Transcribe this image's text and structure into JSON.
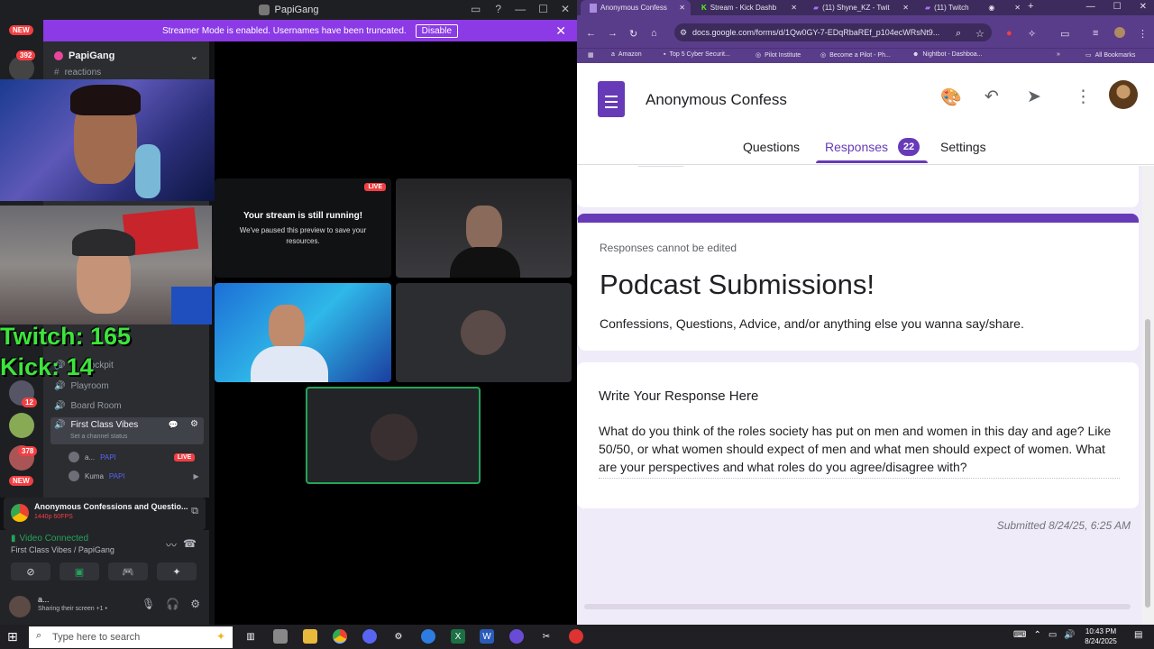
{
  "discord": {
    "window_title": "PapiGang",
    "banner_text": "Streamer Mode is enabled. Usernames have been truncated.",
    "banner_button": "Disable",
    "server_name": "PapiGang",
    "guild_badges": [
      "NEW",
      "392",
      "12",
      "378",
      "NEW"
    ],
    "channels": [
      {
        "label": "reactions",
        "icon": "hash-icon"
      },
      {
        "label": "Cockpit",
        "icon": "speaker-icon"
      },
      {
        "label": "Playroom",
        "icon": "speaker-icon"
      },
      {
        "label": "Board Room",
        "icon": "speaker-icon"
      },
      {
        "label": "First Class Vibes",
        "icon": "speaker-icon",
        "status": "Set a channel status"
      }
    ],
    "members": [
      {
        "name": "a...",
        "tag": "PAPI",
        "live": "LIVE"
      },
      {
        "name": "Kuma",
        "tag": "PAPI"
      }
    ],
    "overlay_counts": {
      "twitch": "Twitch: 165",
      "kick": "Kick: 14"
    },
    "stream_paused": {
      "live": "LIVE",
      "heading": "Your stream is still running!",
      "body": "We've paused this preview to save your resources."
    },
    "screen_share": {
      "title": "Anonymous Confessions and Questio...",
      "quality": "1440p 60FPS"
    },
    "voice": {
      "status": "Video Connected",
      "channel": "First Class Vibes / PapiGang"
    },
    "user": {
      "name": "a...",
      "status": "Sharing their screen +1 •"
    }
  },
  "browser": {
    "tabs": [
      {
        "title": "Anonymous Confess"
      },
      {
        "title": "Stream - Kick Dashb"
      },
      {
        "title": "(11) Shyne_KZ - Twit"
      },
      {
        "title": "(11) Twitch"
      }
    ],
    "url": "docs.google.com/forms/d/1Qw0GY-7-EDqRbaREf_p104ecWRsNt9...",
    "bookmarks": [
      "Amazon",
      "Top 5 Cyber Securit...",
      "Pilot Institute",
      "Become a Pilot - Ph...",
      "Nightbot - Dashboa...",
      "All Bookmarks"
    ],
    "form": {
      "title": "Anonymous Confess",
      "nav": {
        "questions": "Questions",
        "responses": "Responses",
        "responses_count": "22",
        "settings": "Settings"
      },
      "no_edit": "Responses cannot be edited",
      "heading": "Podcast Submissions!",
      "description": "Confessions, Questions, Advice, and/or anything else you wanna say/share.",
      "question": "Write Your Response Here",
      "answer": "What do you think of the roles society has put on men and women in this day and age? Like 50/50, or what women should expect of men and what men should expect of women. What are your perspectives and what roles do you agree/disagree with?",
      "submitted": "Submitted 8/24/25, 6:25 AM"
    }
  },
  "taskbar": {
    "search_placeholder": "Type here to search",
    "time": "10:43 PM",
    "date": "8/24/2025"
  },
  "colors": {
    "discord_purple": "#8b3ae6",
    "forms_purple": "#673ab7",
    "live_red": "#f23f43",
    "counter_green": "#3de43d"
  }
}
